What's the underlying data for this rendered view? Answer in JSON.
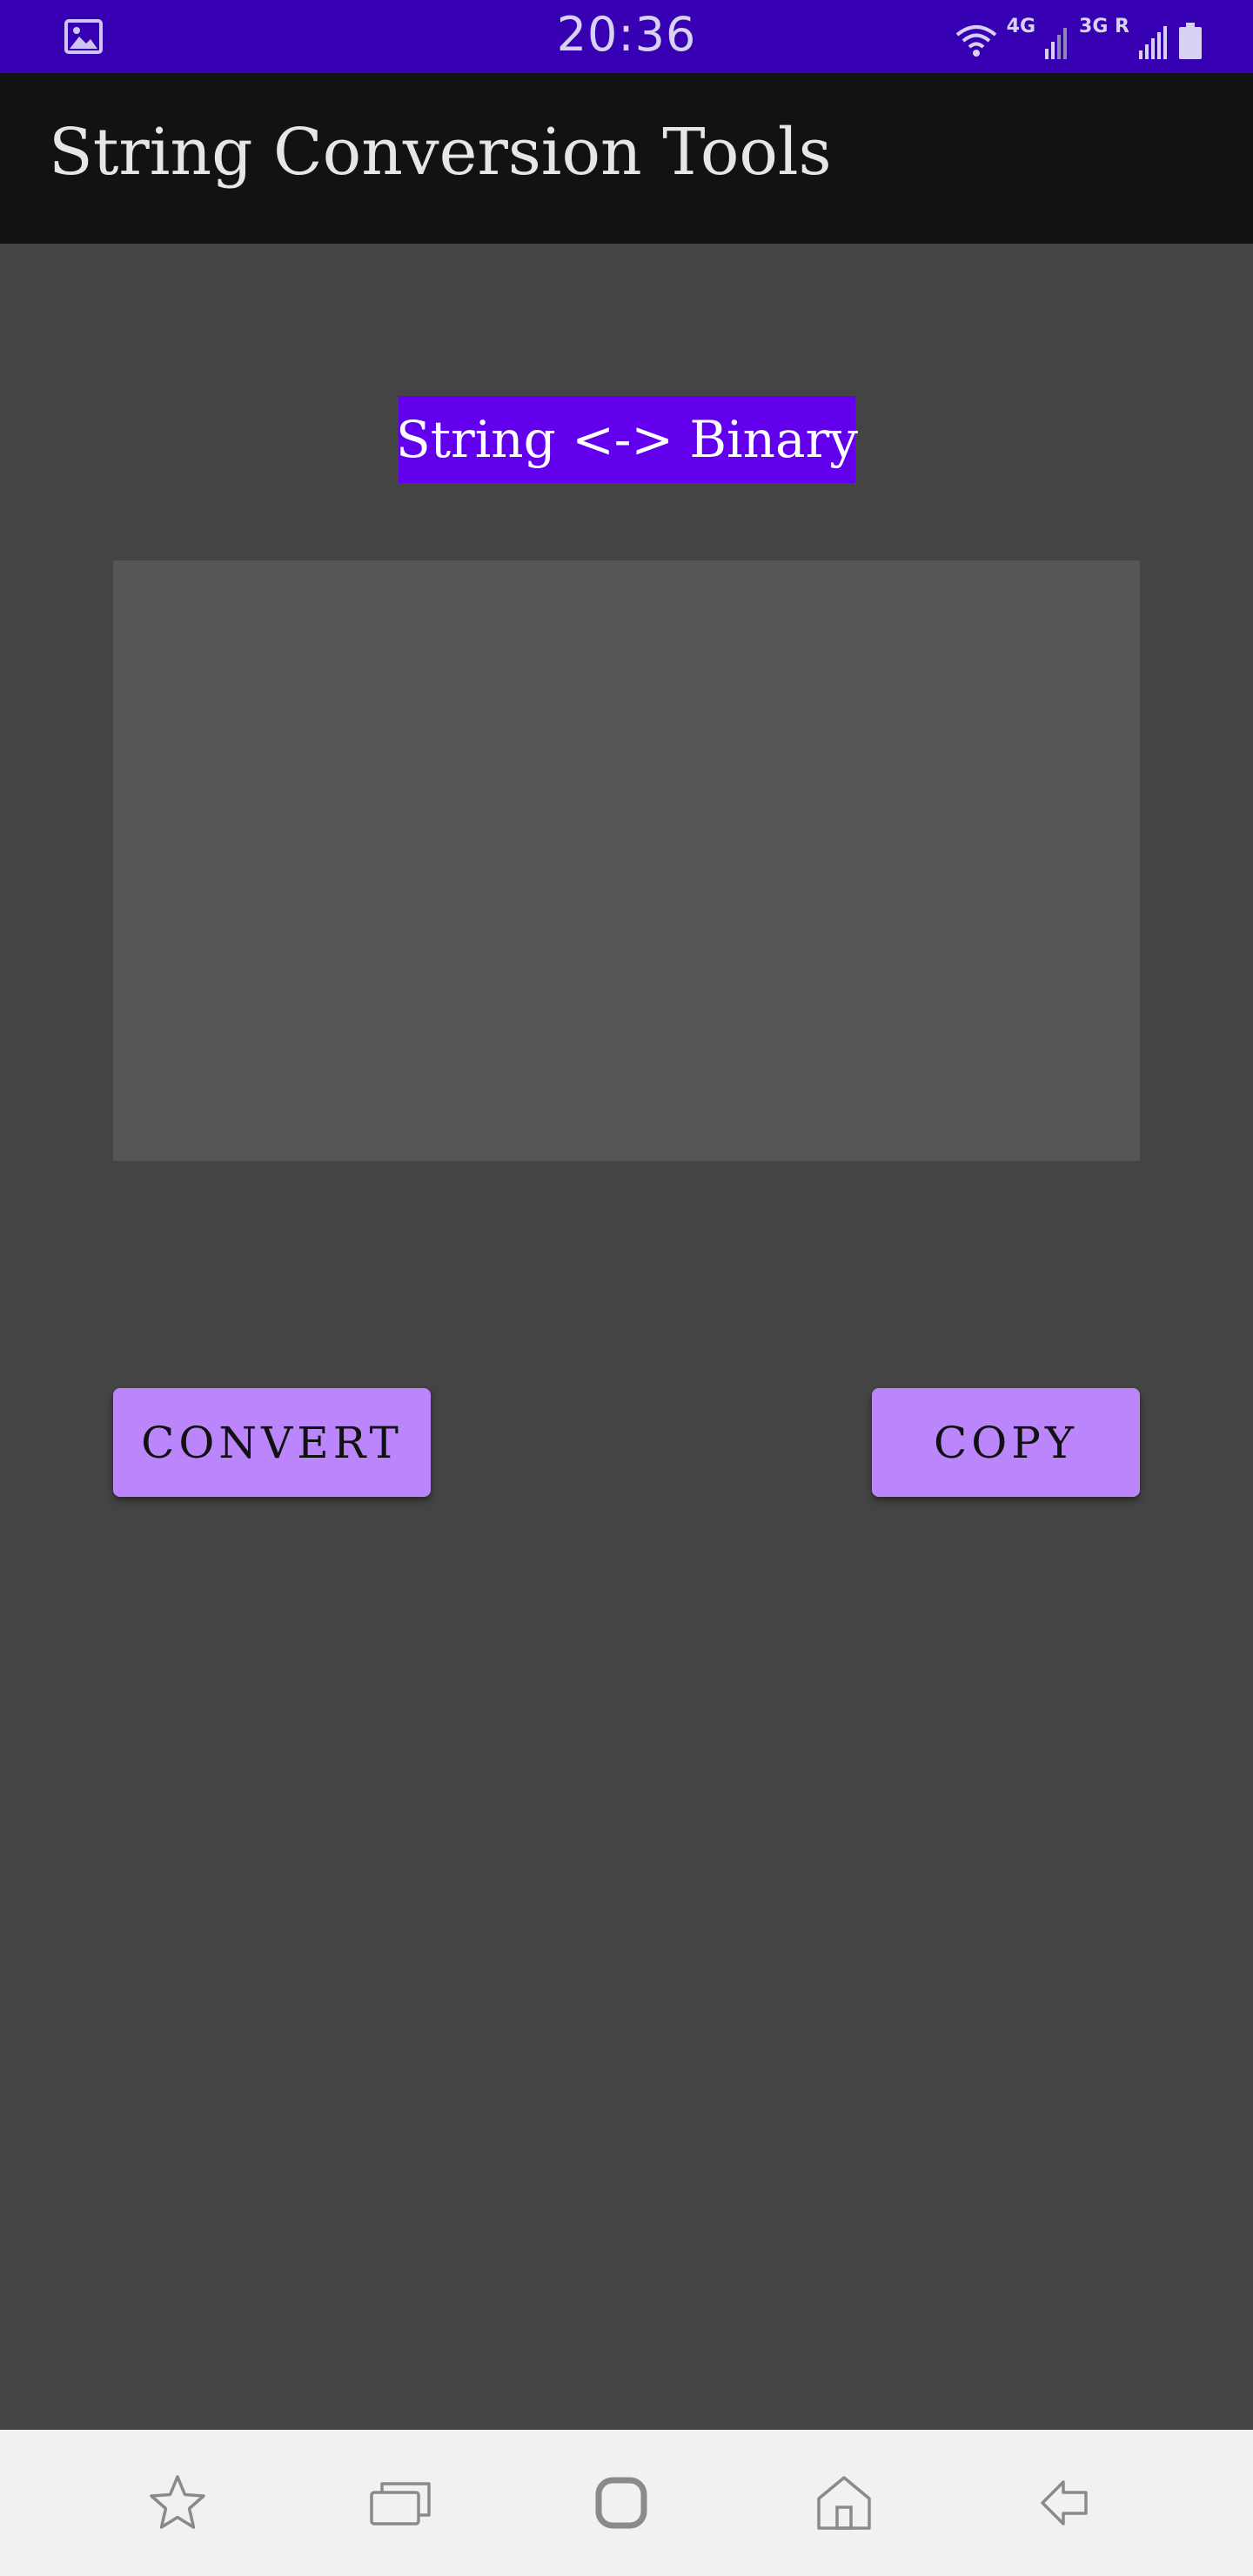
{
  "status_bar": {
    "time": "20:36",
    "network_primary": "4G",
    "network_secondary": "3G R",
    "icons": [
      "gallery-icon",
      "wifi-icon",
      "signal-icon",
      "signal-icon",
      "battery-icon"
    ]
  },
  "app_bar": {
    "title": "String Conversion Tools"
  },
  "main": {
    "mode_label": "String <-> Binary",
    "input_value": "",
    "convert_label": "CONVERT",
    "copy_label": "COPY"
  },
  "nav_bar": {
    "icons": [
      "star-icon",
      "recent-apps-icon",
      "home-circle-icon",
      "home-icon",
      "back-icon"
    ]
  },
  "colors": {
    "status_bar": "#3700b3",
    "app_bar": "#121212",
    "background": "#444444",
    "accent": "#6200ee",
    "button": "#bb86fc",
    "input_bg": "#555555",
    "nav_bar": "#f1f1f1"
  }
}
